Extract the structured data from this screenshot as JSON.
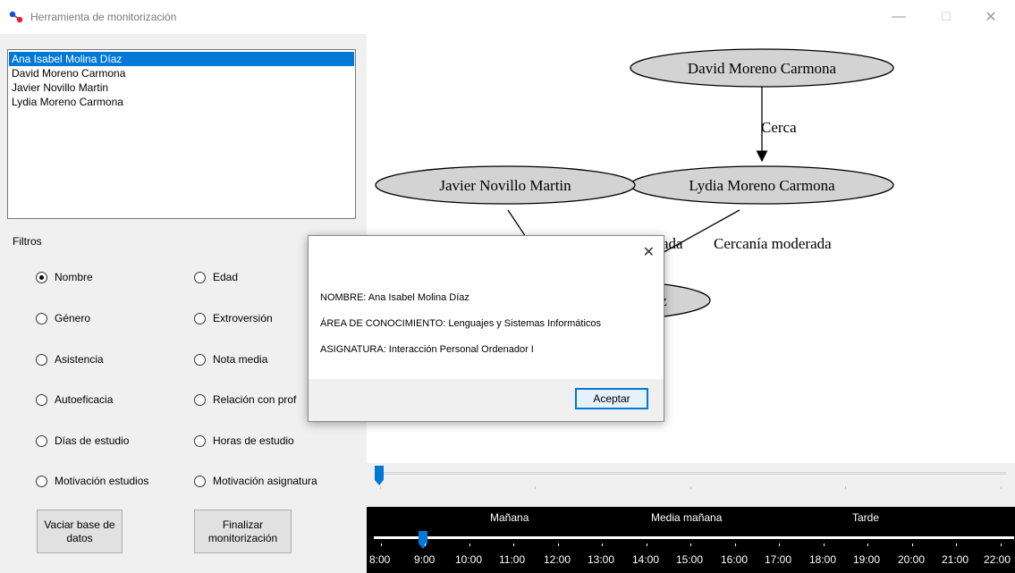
{
  "window": {
    "title": "Herramienta de monitorización",
    "minimize_glyph": "—",
    "maximize_glyph": "☐",
    "close_glyph": "✕"
  },
  "people_list": {
    "items": [
      "Ana Isabel Molina Díaz",
      "David Moreno Carmona",
      "Javier Novillo Martin",
      "Lydia Moreno Carmona"
    ],
    "selected_index": 0
  },
  "filters": {
    "label": "Filtros",
    "options": [
      "Nombre",
      "Edad",
      "Género",
      "Extroversión",
      "Asistencia",
      "Nota media",
      "Autoeficacia",
      "Relación con prof",
      "Días de estudio",
      "Horas de estudio",
      "Motivación estudios",
      "Motivación asignatura"
    ],
    "selected": "Nombre"
  },
  "buttons": {
    "empty_db": "Vaciar base de datos",
    "finish": "Finalizar monitorización"
  },
  "graph": {
    "nodes": [
      "David Moreno Carmona",
      "Lydia Moreno Carmona",
      "Javier Novillo Martin",
      "z"
    ],
    "edges": [
      {
        "from": "David Moreno Carmona",
        "to": "Lydia Moreno Carmona",
        "label": "Cerca"
      },
      {
        "from": "Lydia Moreno Carmona",
        "to": "Ana Isabel Molina Díaz",
        "label": "Cercanía moderada"
      },
      {
        "from": "Javier Novillo Martin",
        "to": "Ana Isabel Molina Díaz",
        "label": "ada"
      }
    ]
  },
  "timeline": {
    "periods": [
      "Mañana",
      "Media mañana",
      "Tarde"
    ],
    "hours": [
      "8:00",
      "9:00",
      "10:00",
      "11:00",
      "12:00",
      "13:00",
      "14:00",
      "15:00",
      "16:00",
      "17:00",
      "18:00",
      "19:00",
      "20:00",
      "21:00",
      "22:00"
    ],
    "selected_hour": "9:00"
  },
  "dialog": {
    "close_glyph": "✕",
    "lines": [
      "NOMBRE: Ana Isabel Molina Díaz",
      "ÁREA DE CONOCIMIENTO: Lenguajes y Sistemas Informáticos",
      "ASIGNATURA: Interacción Personal Ordenador I"
    ],
    "ok_label": "Aceptar"
  },
  "colors": {
    "accent": "#0078d7",
    "node_fill": "#d3d3d3",
    "timeline_bg": "#000000"
  }
}
